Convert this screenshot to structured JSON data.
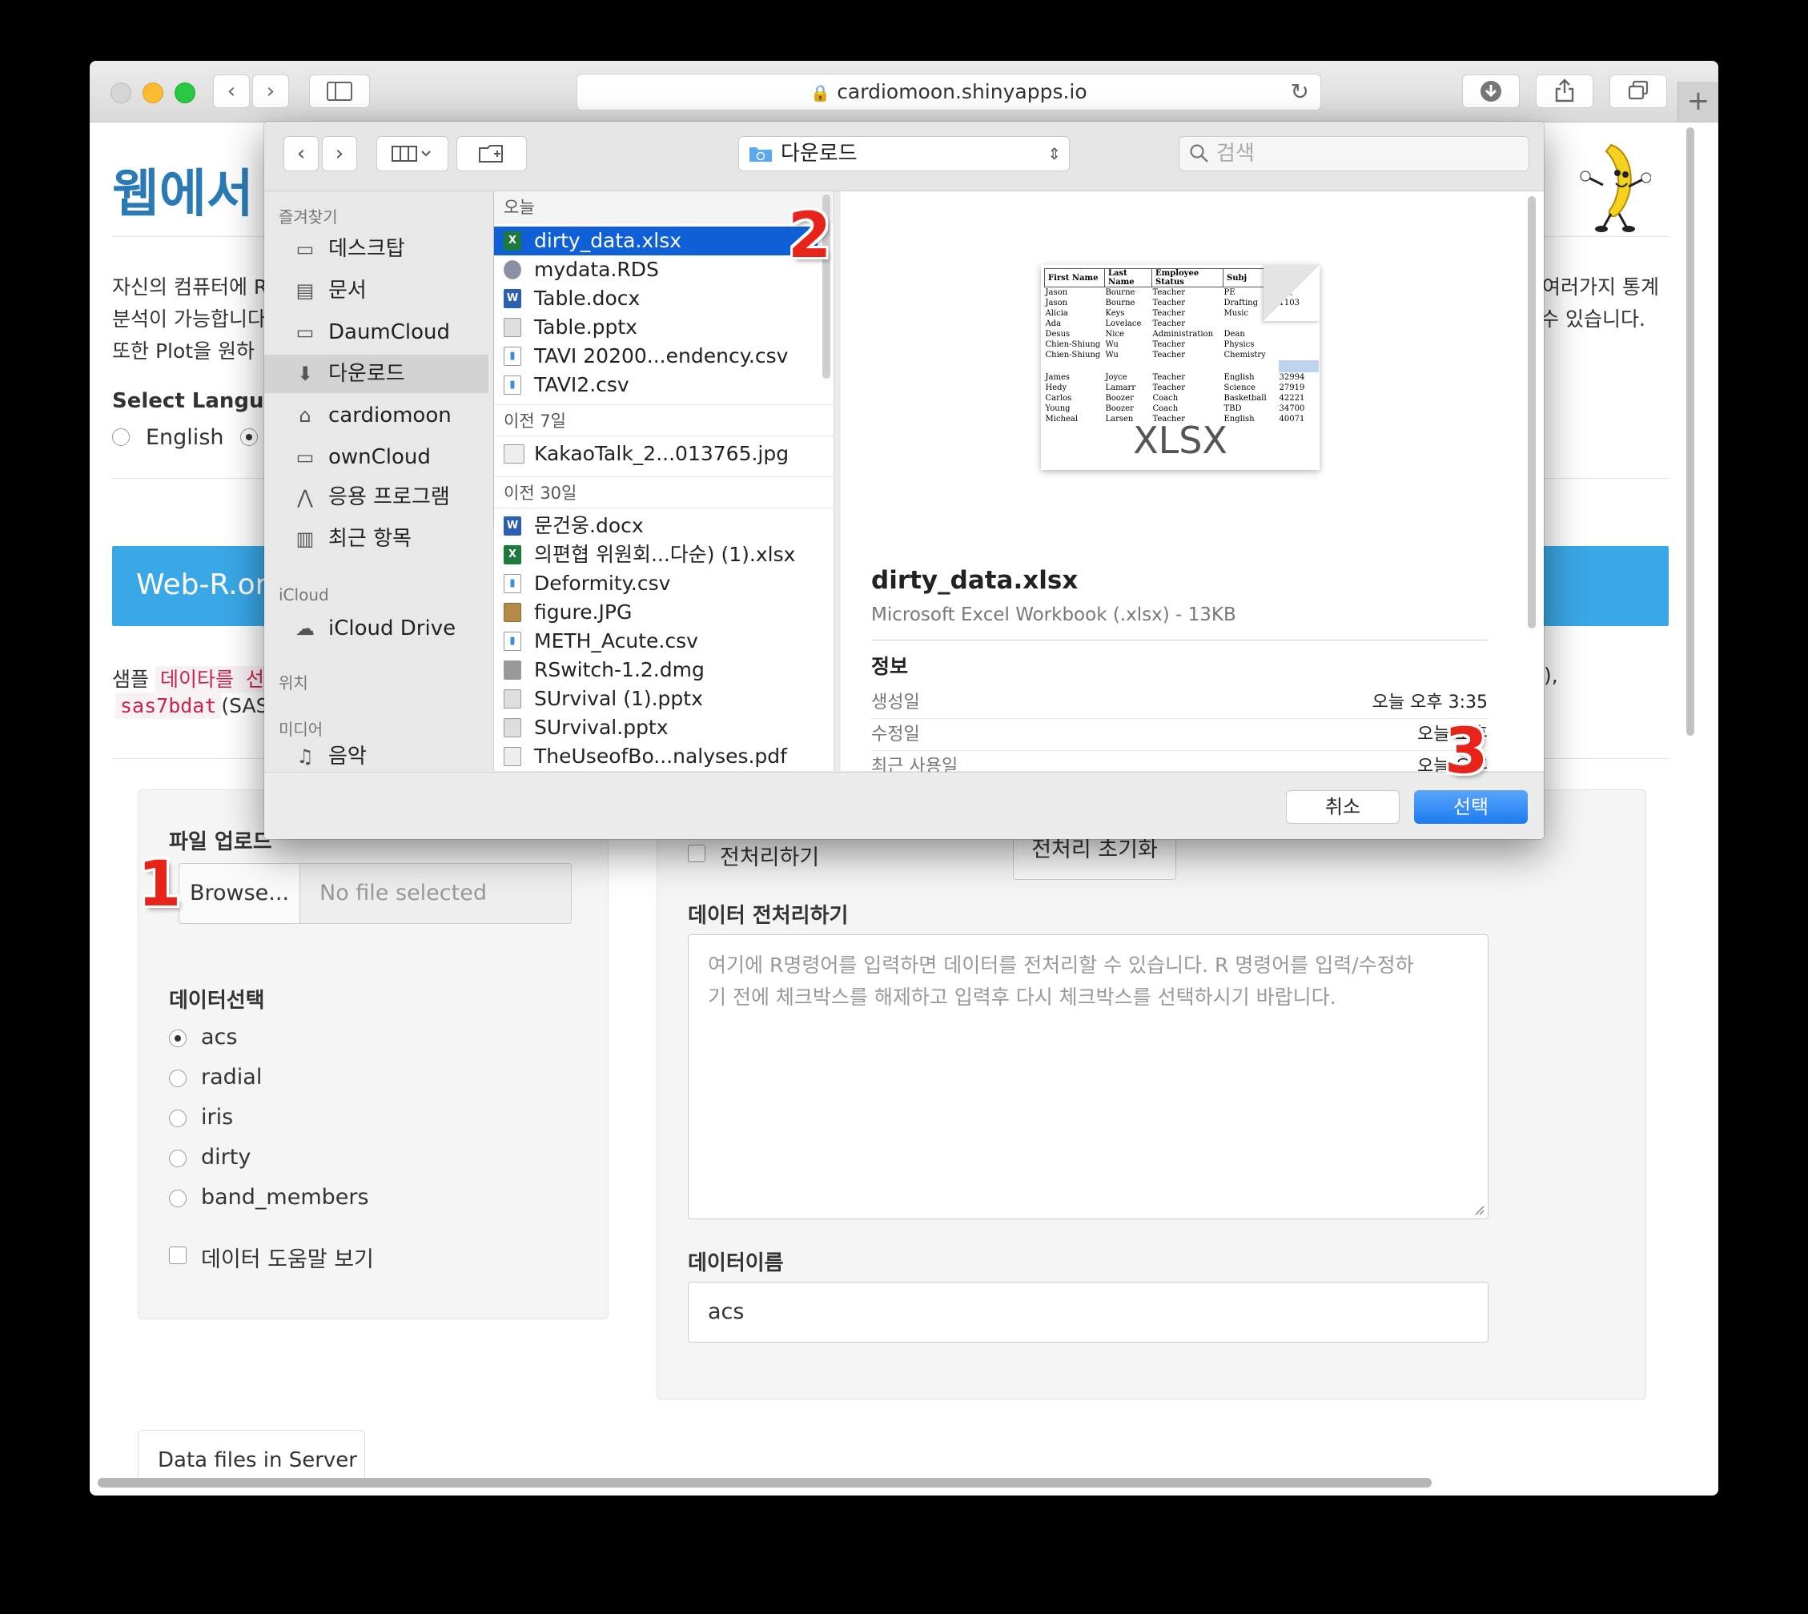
{
  "browser": {
    "url": "cardiomoon.shinyapps.io",
    "nav_back": "‹",
    "nav_forward": "›",
    "new_tab": "+"
  },
  "page": {
    "title": "웹에서",
    "intro_line1_left": "자신의 컴퓨터에 R",
    "intro_line1_right": "여러가지 통계",
    "intro_line2_left": "분석이 가능합니다",
    "intro_line2_right": "수 있습니다.",
    "intro_line3_left": "또한 Plot을 원하",
    "select_language": "Select Langua",
    "language_english": "English",
    "banner": "Web-R.org",
    "sample_prefix": "샘플",
    "sample_code": "데이타를 선",
    "sample_code2": "sas7bdat",
    "sample_code2_suffix": "(SAS",
    "sample_trailing": "),"
  },
  "upload_panel": {
    "label": "파일 업로드",
    "browse_button": "Browse...",
    "file_placeholder": "No file selected",
    "data_select_label": "데이터선택",
    "datasets": [
      "acs",
      "radial",
      "iris",
      "dirty",
      "band_members"
    ],
    "selected_dataset": "acs",
    "help_checkbox": "데이터 도움말 보기",
    "server_tab": "Data files in Server"
  },
  "preprocess_panel": {
    "preprocess_checkbox": "전처리하기",
    "reset_button": "전처리 초기화",
    "preprocess_label": "데이터 전처리하기",
    "textarea_placeholder_line1": "여기에 R명령어를 입력하면 데이터를 전처리할 수 있습니다. R 명령어를 입력/수정하",
    "textarea_placeholder_line2": "기 전에 체크박스를 해제하고 입력후 다시 체크박스를 선택하시기 바랍니다.",
    "data_name_label": "데이터이름",
    "data_name_value": "acs"
  },
  "dialog": {
    "location": "다운로드",
    "search_placeholder": "검색",
    "sidebar": {
      "favorites_header": "즐겨찾기",
      "favorites": [
        "데스크탑",
        "문서",
        "DaumCloud",
        "다운로드",
        "cardiomoon",
        "ownCloud",
        "응용 프로그램",
        "최근 항목"
      ],
      "icloud_header": "iCloud",
      "icloud": [
        "iCloud Drive"
      ],
      "location_header": "위치",
      "media_header": "미디어",
      "media": [
        "음악"
      ]
    },
    "groups": [
      {
        "header": "오늘",
        "files": [
          "dirty_data.xlsx",
          "mydata.RDS",
          "Table.docx",
          "Table.pptx",
          "TAVI 20200...endency.csv",
          "TAVI2.csv"
        ]
      },
      {
        "header": "이전 7일",
        "files": [
          "KakaoTalk_2...013765.jpg"
        ]
      },
      {
        "header": "이전 30일",
        "files": [
          "문건웅.docx",
          "의편협 위원회...다순) (1).xlsx",
          "Deformity.csv",
          "figure.JPG",
          "METH_Acute.csv",
          "RSwitch-1.2.dmg",
          "SUrvival (1).pptx",
          "SUrvival.pptx",
          "TheUseofBo...nalyses.pdf"
        ]
      }
    ],
    "selected_file": "dirty_data.xlsx",
    "preview": {
      "filename": "dirty_data.xlsx",
      "kind": "Microsoft Excel Workbook (.xlsx) - 13KB",
      "info_header": "정보",
      "thumb_label": "XLSX",
      "thumb_headers": [
        "First Name",
        "Last Name",
        "Employee Status",
        "Subj"
      ],
      "thumb_rows": [
        [
          "Jason",
          "Bourne",
          "Teacher",
          "PE"
        ],
        [
          "Jason",
          "Bourne",
          "Teacher",
          "Drafting"
        ],
        [
          "Alicia",
          "Keys",
          "Teacher",
          "Music"
        ],
        [
          "Ada",
          "Lovelace",
          "Teacher",
          ""
        ],
        [
          "Desus",
          "Nice",
          "Administration",
          "Dean"
        ],
        [
          "Chien-Shiung",
          "Wu",
          "Teacher",
          "Physics"
        ],
        [
          "Chien-Shiung",
          "Wu",
          "Teacher",
          "Chemistry"
        ],
        [
          "",
          "",
          "",
          ""
        ],
        [
          "James",
          "Joyce",
          "Teacher",
          "English"
        ],
        [
          "Hedy",
          "Lamarr",
          "Teacher",
          "Science"
        ],
        [
          "Carlos",
          "Boozer",
          "Coach",
          "Basketball"
        ],
        [
          "Young",
          "Boozer",
          "Coach",
          "TBD"
        ],
        [
          "Micheal",
          "Larsen",
          "Teacher",
          "English"
        ]
      ],
      "thumb_nums": [
        "11(",
        "1103",
        "",
        "",
        "",
        "",
        "",
        "",
        "32994",
        "27919",
        "42221",
        "34700",
        "40071"
      ],
      "info": [
        {
          "label": "생성일",
          "value": "오늘 오후 3:35"
        },
        {
          "label": "수정일",
          "value": "오늘 오후"
        },
        {
          "label": "최근 사용일",
          "value": "오늘 오후"
        }
      ]
    },
    "cancel_button": "취소",
    "choose_button": "선택"
  },
  "annotations": {
    "step1": "1",
    "step2": "2",
    "step3": "3"
  },
  "colors": {
    "accent": "#2a7bb5",
    "selection": "#0f5fd6",
    "badge": "#e8231a",
    "banner": "#3aa7e6"
  }
}
